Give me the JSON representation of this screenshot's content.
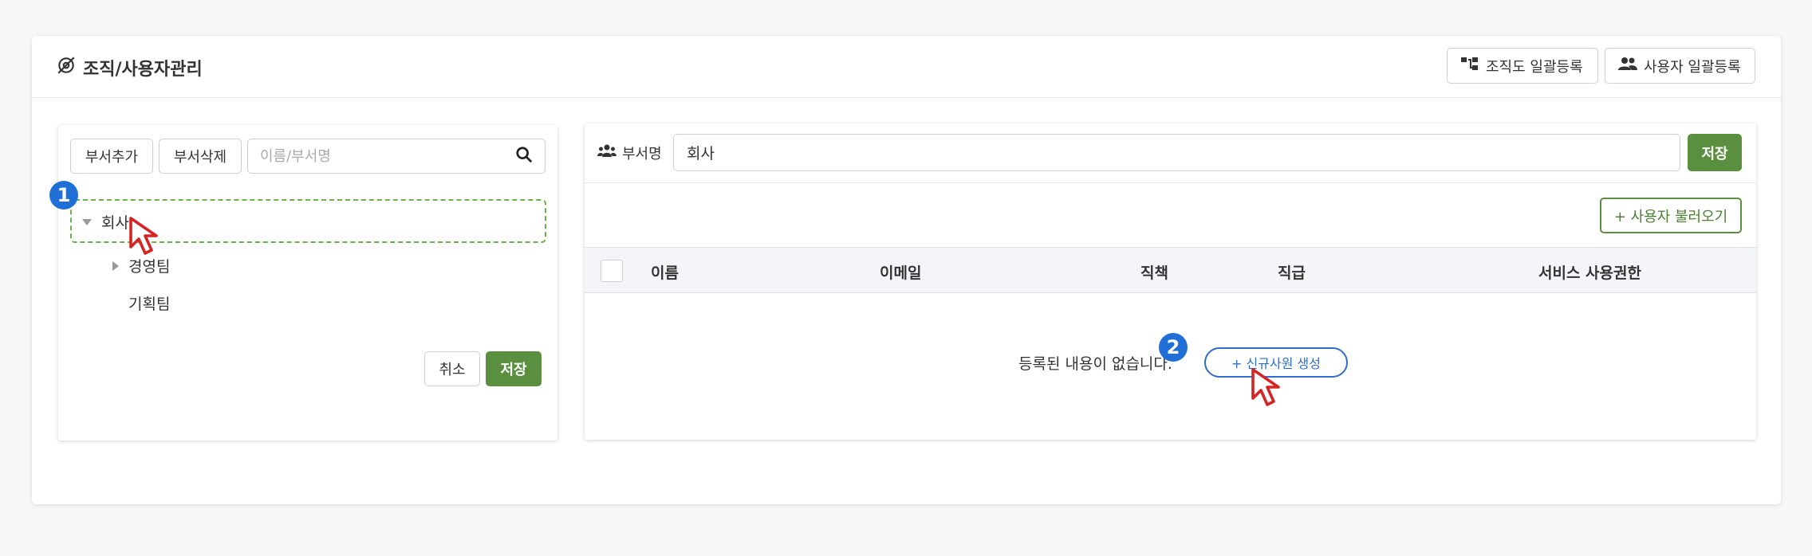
{
  "header": {
    "title": "조직/사용자관리",
    "org_bulk_label": "조직도 일괄등록",
    "user_bulk_label": "사용자 일괄등록"
  },
  "left_panel": {
    "add_dept_label": "부서추가",
    "delete_dept_label": "부서삭제",
    "search_placeholder": "이름/부서명",
    "search_value": "",
    "tree": [
      {
        "label": "회사",
        "expanded": true,
        "selected": true
      },
      {
        "label": "경영팀",
        "expanded": false,
        "selected": false
      },
      {
        "label": "기획팀",
        "expanded": false,
        "selected": false
      }
    ],
    "cancel_label": "취소",
    "save_label": "저장"
  },
  "right_panel": {
    "dept_name_label": "부서명",
    "dept_name_value": "회사",
    "save_label": "저장",
    "load_users_label": "+ 사용자 불러오기",
    "columns": [
      "이름",
      "이메일",
      "직책",
      "직급",
      "서비스 사용권한"
    ],
    "empty_message": "등록된 내용이 없습니다.",
    "new_employee_label": "+ 신규사원 생성"
  },
  "annotations": {
    "step1": "1",
    "step2": "2"
  },
  "colors": {
    "primary_green": "#5a8f3f",
    "selection_dash": "#6cb04e",
    "badge_blue": "#1f6fd6",
    "link_blue": "#2f6ec7"
  }
}
